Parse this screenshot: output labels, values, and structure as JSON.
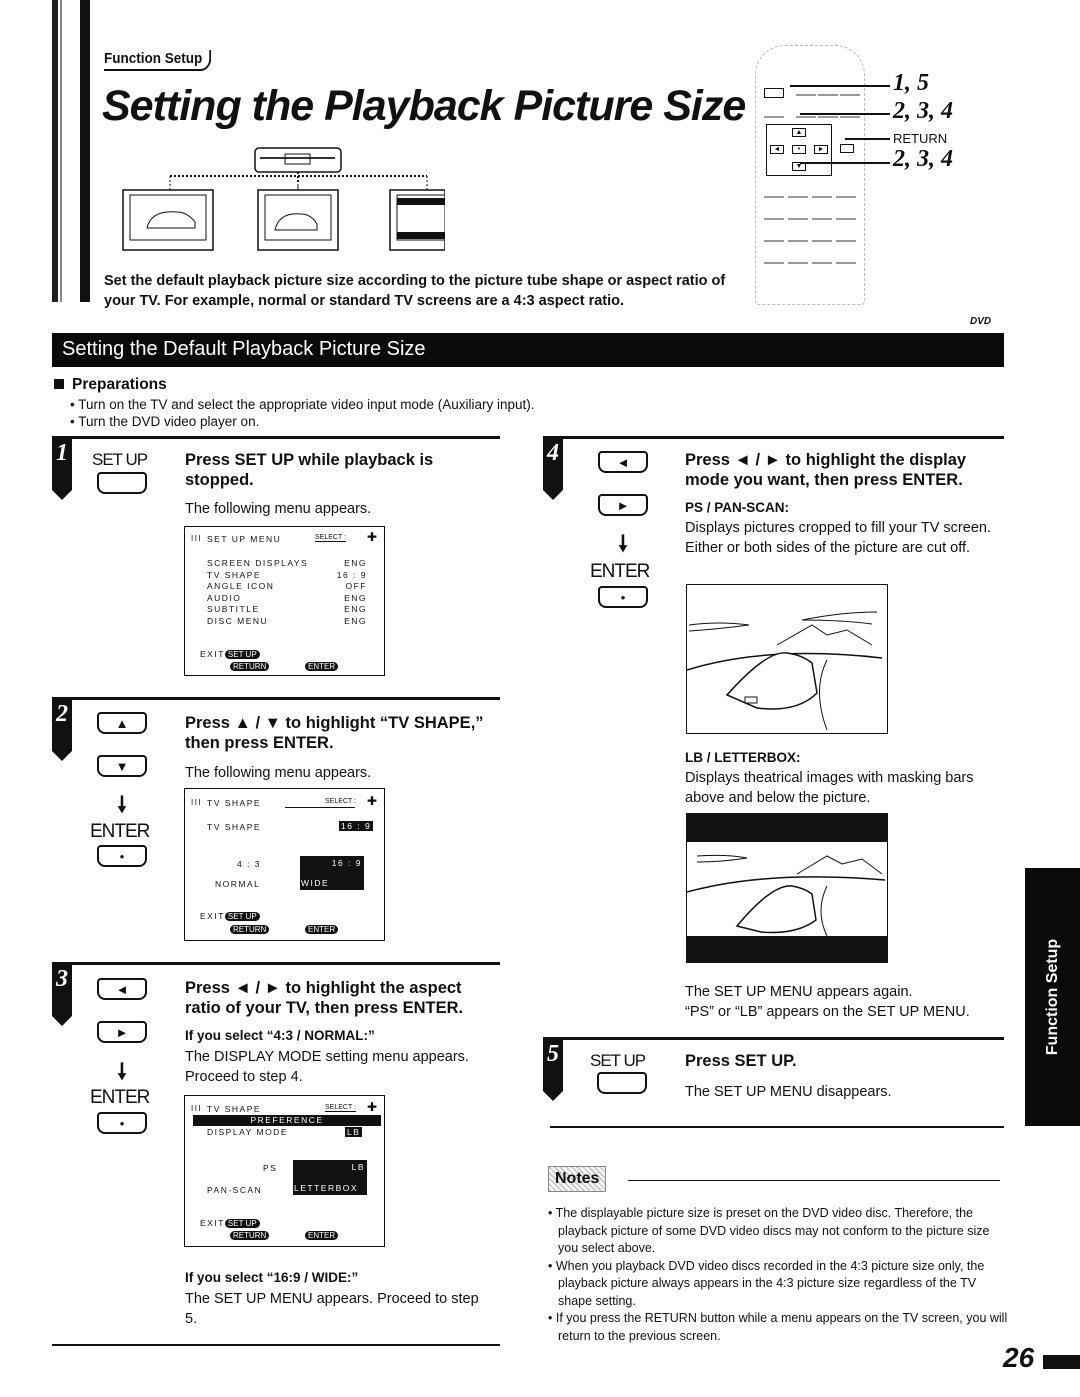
{
  "header": {
    "section_tag": "Function Setup",
    "title": "Setting the Playback Picture Size",
    "intro": "Set the default playback picture size according to the picture tube shape or aspect ratio of your TV.  For example, normal or standard TV screens are a 4:3 aspect ratio."
  },
  "remote_callouts": {
    "c1": "1, 5",
    "c2": "2, 3, 4",
    "c3": "RETURN",
    "c4": "2, 3, 4"
  },
  "section": {
    "title": "Setting the Default Playback Picture Size",
    "dvd_tag": "DVD"
  },
  "preparations": {
    "heading": "Preparations",
    "items": [
      "• Turn on the TV and select the appropriate video input mode (Auxiliary input).",
      "• Turn the DVD video player on."
    ]
  },
  "steps": {
    "s1": {
      "num": "1",
      "button_label": "SET UP",
      "heading": "Press SET UP while playback is stopped.",
      "text": "The following menu appears.",
      "osd": {
        "title": "SET UP MENU",
        "select": "SELECT :",
        "rows": [
          {
            "label": "SCREEN DISPLAYS",
            "value": "ENG"
          },
          {
            "label": "TV SHAPE",
            "value": "16 : 9"
          },
          {
            "label": "ANGLE ICON",
            "value": "OFF"
          },
          {
            "label": "AUDIO",
            "value": "ENG"
          },
          {
            "label": "SUBTITLE",
            "value": "ENG"
          },
          {
            "label": "DISC MENU",
            "value": "ENG"
          }
        ],
        "exit": "EXIT",
        "setup_pill": "SET UP",
        "return_pill": "RETURN",
        "enter_pill": "ENTER"
      }
    },
    "s2": {
      "num": "2",
      "enter_label": "ENTER",
      "heading": "Press ▲ / ▼ to highlight “TV SHAPE,” then press ENTER.",
      "text": "The following menu appears.",
      "osd": {
        "title": "TV SHAPE",
        "select": "SELECT :",
        "row_label": "TV SHAPE",
        "row_value": "16 : 9",
        "opt1_ratio": "4 : 3",
        "opt1_name": "NORMAL",
        "opt2_ratio": "16 : 9",
        "opt2_name": "WIDE",
        "exit": "EXIT",
        "setup_pill": "SET UP",
        "return_pill": "RETURN",
        "enter_pill": "ENTER"
      }
    },
    "s3": {
      "num": "3",
      "enter_label": "ENTER",
      "heading": "Press ◄ / ► to highlight the aspect ratio of your TV, then press ENTER.",
      "sub1_head": "If you select “4:3 / NORMAL:”",
      "sub1_text": "The DISPLAY MODE setting menu appears. Proceed to step 4.",
      "osd": {
        "title": "TV SHAPE",
        "select": "SELECT :",
        "band": "PREFERENCE",
        "row_label": "DISPLAY MODE",
        "row_value": "LB",
        "opt1_short": "PS",
        "opt1_name": "PAN-SCAN",
        "opt2_short": "LB",
        "opt2_name": "LETTERBOX",
        "exit": "EXIT",
        "setup_pill": "SET UP",
        "return_pill": "RETURN",
        "enter_pill": "ENTER"
      },
      "sub2_head": "If you select “16:9 / WIDE:”",
      "sub2_text": "The SET UP MENU appears. Proceed to step 5."
    },
    "s4": {
      "num": "4",
      "enter_label": "ENTER",
      "heading": "Press ◄ / ► to highlight the display mode you want, then press ENTER.",
      "ps_head": "PS / PAN-SCAN:",
      "ps_text": "Displays pictures cropped to fill your TV screen. Either or both sides of the picture are cut off.",
      "lb_head": "LB / LETTERBOX:",
      "lb_text": "Displays theatrical images with masking bars above and below the picture.",
      "after1": "The SET UP MENU appears again.",
      "after2": "“PS” or “LB” appears on the SET UP MENU."
    },
    "s5": {
      "num": "5",
      "button_label": "SET UP",
      "heading": "Press SET UP.",
      "text": "The SET UP MENU disappears."
    }
  },
  "notes": {
    "badge": "Notes",
    "items": [
      "• The displayable picture size is preset on the DVD video disc. Therefore, the playback picture of some DVD video discs may not conform to the picture size you select above.",
      "• When you playback DVD video discs recorded in the 4:3 picture size only, the playback picture always appears in the 4:3 picture size regardless of the TV shape setting.",
      "• If you press the RETURN button while a menu appears on the TV screen, you will return to the previous screen."
    ]
  },
  "side_tab": "Function Setup",
  "page_number": "26"
}
